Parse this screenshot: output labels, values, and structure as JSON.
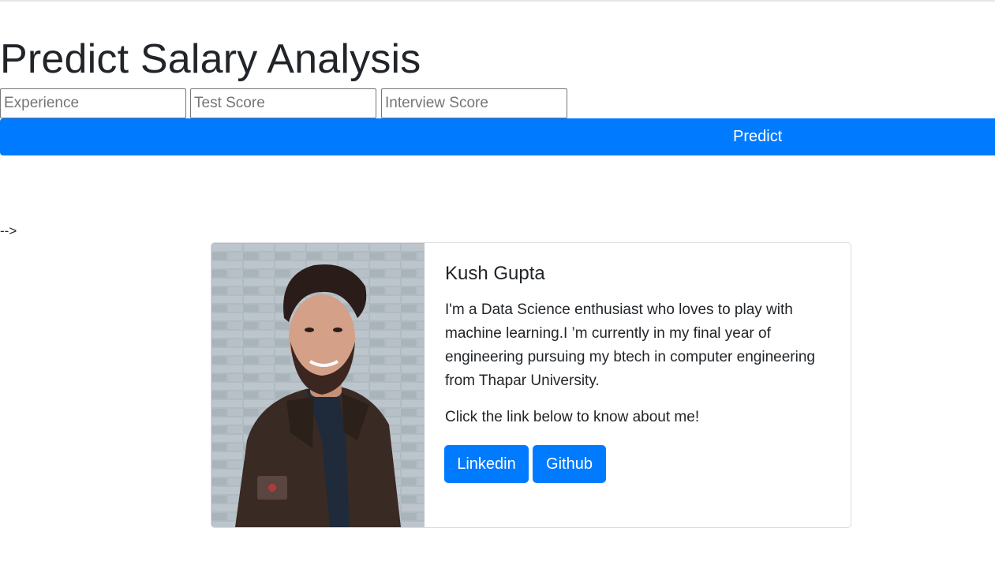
{
  "header": {
    "title": "Predict Salary Analysis"
  },
  "form": {
    "experience_placeholder": "Experience",
    "test_score_placeholder": "Test Score",
    "interview_score_placeholder": "Interview Score",
    "predict_label": "Predict"
  },
  "stray_text": "-->",
  "profile": {
    "name": "Kush Gupta",
    "bio": "I'm a Data Science enthusiast who loves to play with machine learning.I ’m currently in my final year of engineering pursuing my btech in computer engineering from Thapar University.",
    "cta": "Click the link below to know about me!",
    "linkedin_label": "Linkedin",
    "github_label": "Github"
  },
  "colors": {
    "primary": "#007bff",
    "text": "#212529"
  }
}
